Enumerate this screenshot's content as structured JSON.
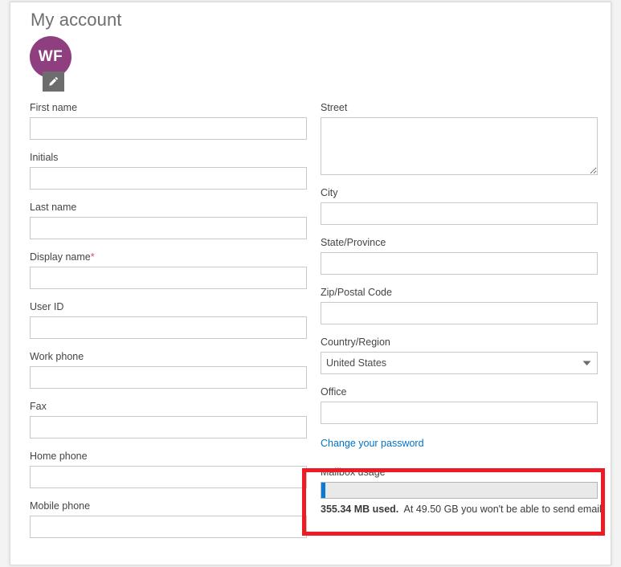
{
  "page": {
    "title": "My account"
  },
  "avatar": {
    "initials": "WF",
    "edit_icon": "pencil-icon",
    "color": "#8f3f80"
  },
  "left_column": {
    "fields": [
      {
        "label": "First name",
        "value": "",
        "placeholder": "",
        "type": "text",
        "required": false
      },
      {
        "label": "Initials",
        "value": "",
        "placeholder": "",
        "type": "text",
        "required": false
      },
      {
        "label": "Last name",
        "value": "",
        "placeholder": "",
        "type": "text",
        "required": false
      },
      {
        "label": "Display name",
        "value": "",
        "placeholder": "",
        "type": "text",
        "required": true,
        "required_mark": "*"
      },
      {
        "label": "User ID",
        "value": "",
        "placeholder": "",
        "type": "text",
        "required": false
      },
      {
        "label": "Work phone",
        "value": "",
        "placeholder": "",
        "type": "text",
        "required": false
      },
      {
        "label": "Fax",
        "value": "",
        "placeholder": "",
        "type": "text",
        "required": false
      },
      {
        "label": "Home phone",
        "value": "",
        "placeholder": "",
        "type": "text",
        "required": false
      },
      {
        "label": "Mobile phone",
        "value": "",
        "placeholder": "",
        "type": "text",
        "required": false
      }
    ]
  },
  "right_column": {
    "street": {
      "label": "Street",
      "value": "",
      "placeholder": "",
      "type": "textarea"
    },
    "city": {
      "label": "City",
      "value": "",
      "placeholder": "",
      "type": "text"
    },
    "state": {
      "label": "State/Province",
      "value": "",
      "placeholder": "",
      "type": "text"
    },
    "zip": {
      "label": "Zip/Postal Code",
      "value": "",
      "placeholder": "",
      "type": "text"
    },
    "country": {
      "label": "Country/Region",
      "selected": "United States",
      "type": "select",
      "arrow_icon": "chevron-down-icon"
    },
    "office": {
      "label": "Office",
      "value": "",
      "placeholder": "",
      "type": "text"
    },
    "password_link": {
      "label": "Change your password",
      "color": "#0072c6"
    }
  },
  "mailbox_usage": {
    "label": "Mailbox usage",
    "used_text": "355.34 MB used.",
    "limit_text": "At 49.50 GB you won't be able to send email.",
    "fill_percent": 1,
    "fill_color": "#0a7ad4",
    "track_color": "#e9e9e9"
  },
  "annotation": {
    "highlight_color": "#ed1c24",
    "target": "mailbox-usage-section"
  }
}
